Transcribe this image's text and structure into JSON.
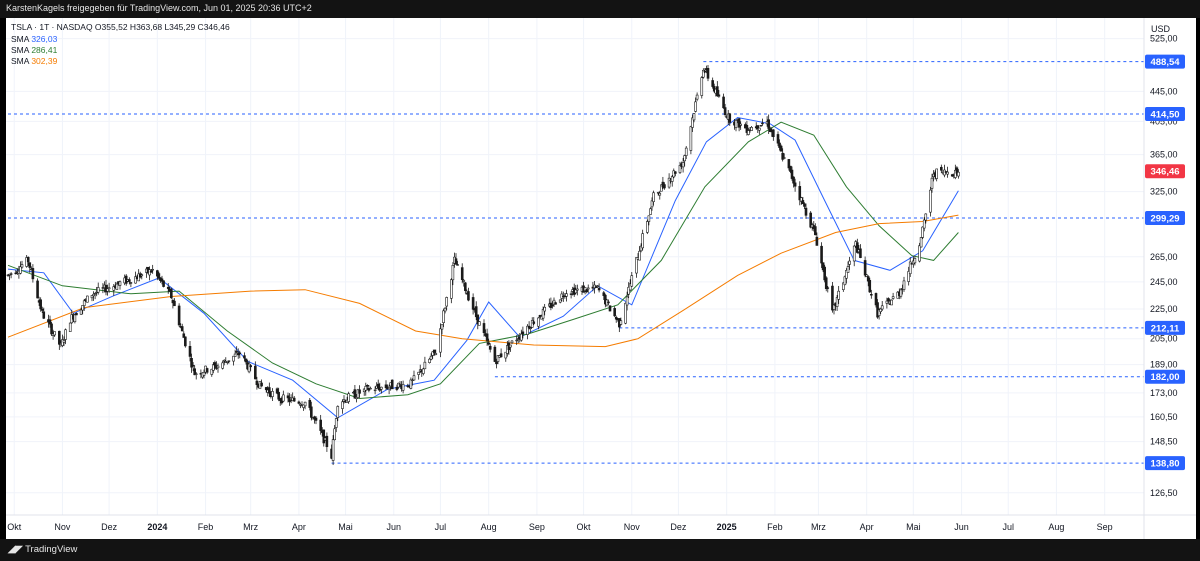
{
  "header_text": "KarstenKagels freigegeben für TradingView.com, Jun 01, 2025 20:36 UTC+2",
  "branding": "TradingView",
  "colors": {
    "up": "#1a1a1a",
    "down": "#1a1a1a",
    "sma1": "#2962ff",
    "sma2": "#2e7d32",
    "sma3": "#f57c00",
    "grid": "#f0f3fa",
    "hline": "#2962ff",
    "price_badge": "#f23645",
    "level_badge": "#2962ff"
  },
  "legend": {
    "symbol_line": "TSLA · 1T · NASDAQ",
    "ohlc": {
      "o_label": "O",
      "o": "355,52",
      "h_label": "H",
      "h": "363,68",
      "l_label": "L",
      "l": "345,29",
      "c_label": "C",
      "c": "346,46"
    },
    "sma": [
      {
        "label": "SMA",
        "value": "326,03"
      },
      {
        "label": "SMA",
        "value": "286,41"
      },
      {
        "label": "SMA",
        "value": "302,39"
      }
    ]
  },
  "chart_data": {
    "type": "candlestick",
    "symbol": "TSLA",
    "exchange": "NASDAQ",
    "interval": "1T",
    "currency": "USD",
    "y_scale": "log",
    "ylim": [
      118,
      560
    ],
    "y_ticks": [
      "525,00",
      "445,00",
      "405,00",
      "365,00",
      "325,00",
      "265,00",
      "245,00",
      "225,00",
      "205,00",
      "189,00",
      "173,00",
      "160,50",
      "148,50",
      "126,50"
    ],
    "x_months": [
      "Okt",
      "Nov",
      "Dez",
      "2024",
      "Feb",
      "Mrz",
      "Apr",
      "Mai",
      "Jun",
      "Jul",
      "Aug",
      "Sep",
      "Okt",
      "Nov",
      "Dez",
      "2025",
      "Feb",
      "Mrz",
      "Apr",
      "Mai",
      "Jun",
      "Jul",
      "Aug",
      "Sep"
    ],
    "bold_x_labels": [
      "2024",
      "2025"
    ],
    "last_price": "346,46",
    "horizontal_levels": [
      {
        "value": "488,54",
        "since": "2024-12-17"
      },
      {
        "value": "414,50",
        "since": "2023-09-27"
      },
      {
        "value": "299,29",
        "since": "2023-09-27"
      },
      {
        "value": "212,11",
        "since": "2024-10-24"
      },
      {
        "value": "182,00",
        "since": "2024-08-05"
      },
      {
        "value": "138,80",
        "since": "2024-04-22"
      }
    ],
    "series_path": [
      {
        "date": "2023-09-27",
        "close": 250
      },
      {
        "date": "2023-10-10",
        "close": 262
      },
      {
        "date": "2023-10-19",
        "close": 222
      },
      {
        "date": "2023-10-31",
        "close": 200
      },
      {
        "date": "2023-11-06",
        "close": 218
      },
      {
        "date": "2023-11-20",
        "close": 236
      },
      {
        "date": "2023-12-08",
        "close": 244
      },
      {
        "date": "2023-12-29",
        "close": 254
      },
      {
        "date": "2024-01-10",
        "close": 234
      },
      {
        "date": "2024-01-25",
        "close": 184
      },
      {
        "date": "2024-02-08",
        "close": 188
      },
      {
        "date": "2024-02-23",
        "close": 196
      },
      {
        "date": "2024-03-07",
        "close": 177
      },
      {
        "date": "2024-03-20",
        "close": 170
      },
      {
        "date": "2024-04-05",
        "close": 168
      },
      {
        "date": "2024-04-19",
        "close": 147
      },
      {
        "date": "2024-04-22",
        "close": 142
      },
      {
        "date": "2024-04-26",
        "close": 168
      },
      {
        "date": "2024-05-15",
        "close": 175
      },
      {
        "date": "2024-06-12",
        "close": 178
      },
      {
        "date": "2024-06-28",
        "close": 197
      },
      {
        "date": "2024-07-10",
        "close": 262
      },
      {
        "date": "2024-07-24",
        "close": 220
      },
      {
        "date": "2024-08-05",
        "close": 191
      },
      {
        "date": "2024-08-26",
        "close": 213
      },
      {
        "date": "2024-09-20",
        "close": 238
      },
      {
        "date": "2024-10-10",
        "close": 240
      },
      {
        "date": "2024-10-24",
        "close": 215
      },
      {
        "date": "2024-11-01",
        "close": 248
      },
      {
        "date": "2024-11-15",
        "close": 320
      },
      {
        "date": "2024-12-04",
        "close": 357
      },
      {
        "date": "2024-12-17",
        "close": 480
      },
      {
        "date": "2025-01-02",
        "close": 410
      },
      {
        "date": "2025-01-14",
        "close": 396
      },
      {
        "date": "2025-01-27",
        "close": 404
      },
      {
        "date": "2025-02-12",
        "close": 340
      },
      {
        "date": "2025-02-27",
        "close": 284
      },
      {
        "date": "2025-03-10",
        "close": 222
      },
      {
        "date": "2025-03-25",
        "close": 276
      },
      {
        "date": "2025-04-08",
        "close": 222
      },
      {
        "date": "2025-04-22",
        "close": 237
      },
      {
        "date": "2025-05-06",
        "close": 280
      },
      {
        "date": "2025-05-14",
        "close": 345
      },
      {
        "date": "2025-05-30",
        "close": 346
      }
    ],
    "sma_series": [
      {
        "name": "SMA",
        "value": "326,03",
        "points": [
          {
            "date": "2023-09-27",
            "value": 255
          },
          {
            "date": "2023-10-20",
            "value": 252
          },
          {
            "date": "2023-11-08",
            "value": 222
          },
          {
            "date": "2023-12-05",
            "value": 235
          },
          {
            "date": "2024-01-02",
            "value": 248
          },
          {
            "date": "2024-01-31",
            "value": 222
          },
          {
            "date": "2024-02-28",
            "value": 191
          },
          {
            "date": "2024-03-28",
            "value": 180
          },
          {
            "date": "2024-04-26",
            "value": 160
          },
          {
            "date": "2024-05-28",
            "value": 175
          },
          {
            "date": "2024-06-27",
            "value": 180
          },
          {
            "date": "2024-07-18",
            "value": 204
          },
          {
            "date": "2024-08-01",
            "value": 230
          },
          {
            "date": "2024-08-21",
            "value": 206
          },
          {
            "date": "2024-09-18",
            "value": 220
          },
          {
            "date": "2024-10-10",
            "value": 242
          },
          {
            "date": "2024-11-01",
            "value": 228
          },
          {
            "date": "2024-11-29",
            "value": 316
          },
          {
            "date": "2024-12-19",
            "value": 380
          },
          {
            "date": "2025-01-08",
            "value": 410
          },
          {
            "date": "2025-01-29",
            "value": 402
          },
          {
            "date": "2025-02-14",
            "value": 382
          },
          {
            "date": "2025-03-05",
            "value": 316
          },
          {
            "date": "2025-03-24",
            "value": 262
          },
          {
            "date": "2025-04-16",
            "value": 254
          },
          {
            "date": "2025-05-07",
            "value": 270
          },
          {
            "date": "2025-05-30",
            "value": 326
          }
        ]
      },
      {
        "name": "SMA",
        "value": "286,41",
        "points": [
          {
            "date": "2023-09-27",
            "value": 258
          },
          {
            "date": "2023-11-01",
            "value": 242
          },
          {
            "date": "2023-12-15",
            "value": 236
          },
          {
            "date": "2024-01-15",
            "value": 238
          },
          {
            "date": "2024-02-15",
            "value": 210
          },
          {
            "date": "2024-03-15",
            "value": 190
          },
          {
            "date": "2024-04-12",
            "value": 178
          },
          {
            "date": "2024-05-10",
            "value": 170
          },
          {
            "date": "2024-06-10",
            "value": 172
          },
          {
            "date": "2024-07-01",
            "value": 178
          },
          {
            "date": "2024-07-26",
            "value": 202
          },
          {
            "date": "2024-08-26",
            "value": 208
          },
          {
            "date": "2024-09-25",
            "value": 218
          },
          {
            "date": "2024-10-23",
            "value": 228
          },
          {
            "date": "2024-11-20",
            "value": 262
          },
          {
            "date": "2024-12-18",
            "value": 330
          },
          {
            "date": "2025-01-15",
            "value": 380
          },
          {
            "date": "2025-02-05",
            "value": 404
          },
          {
            "date": "2025-02-26",
            "value": 388
          },
          {
            "date": "2025-03-19",
            "value": 330
          },
          {
            "date": "2025-04-09",
            "value": 292
          },
          {
            "date": "2025-04-30",
            "value": 266
          },
          {
            "date": "2025-05-14",
            "value": 262
          },
          {
            "date": "2025-05-30",
            "value": 286
          }
        ]
      },
      {
        "name": "SMA",
        "value": "302,39",
        "points": [
          {
            "date": "2023-09-27",
            "value": 206
          },
          {
            "date": "2023-11-15",
            "value": 226
          },
          {
            "date": "2024-01-10",
            "value": 234
          },
          {
            "date": "2024-03-01",
            "value": 238
          },
          {
            "date": "2024-04-05",
            "value": 239
          },
          {
            "date": "2024-05-10",
            "value": 229
          },
          {
            "date": "2024-06-15",
            "value": 210
          },
          {
            "date": "2024-07-15",
            "value": 205
          },
          {
            "date": "2024-08-30",
            "value": 201
          },
          {
            "date": "2024-10-15",
            "value": 200
          },
          {
            "date": "2024-11-05",
            "value": 205
          },
          {
            "date": "2024-12-04",
            "value": 224
          },
          {
            "date": "2025-01-08",
            "value": 250
          },
          {
            "date": "2025-02-05",
            "value": 268
          },
          {
            "date": "2025-03-12",
            "value": 286
          },
          {
            "date": "2025-04-09",
            "value": 294
          },
          {
            "date": "2025-05-07",
            "value": 296
          },
          {
            "date": "2025-05-30",
            "value": 302
          }
        ]
      }
    ]
  }
}
